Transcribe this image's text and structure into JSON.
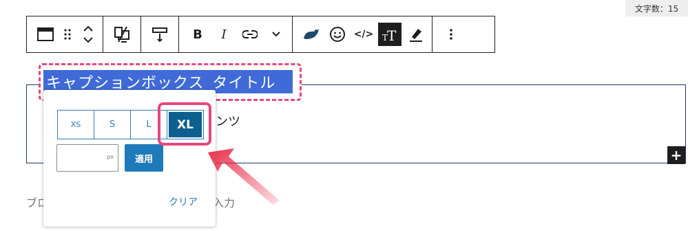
{
  "status": {
    "word_count": "文字数：15"
  },
  "toolbar": {
    "groups": [
      [
        "block-type",
        "drag-handle",
        "move-updown"
      ],
      [
        "transform-block"
      ],
      [
        "align-vertical"
      ],
      [
        "bold",
        "italic",
        "link",
        "more-rich-text"
      ],
      [
        "swell-icon",
        "emoji",
        "code",
        "font-size",
        "highlight"
      ],
      [
        "options"
      ]
    ],
    "labels": {
      "bold": "B",
      "italic": "I",
      "code": "</>",
      "font_size": "T"
    }
  },
  "caption_box": {
    "title": "キャプションボックス_タイトル",
    "content": "ンツ"
  },
  "placeholder": {
    "left": "ブロ",
    "right": "入力"
  },
  "popover": {
    "sizes": [
      "XS",
      "S",
      "L",
      "XL"
    ],
    "selected": "XL",
    "input_value": "",
    "input_unit": "px",
    "apply_label": "適用",
    "clear_label": "クリア"
  },
  "colors": {
    "accent": "#2e7ab8",
    "selected": "#0c5f8f",
    "highlight": "#e8467c",
    "title_bg": "#3f6ad8",
    "arrow": "#e8304a"
  },
  "add_button": "+"
}
